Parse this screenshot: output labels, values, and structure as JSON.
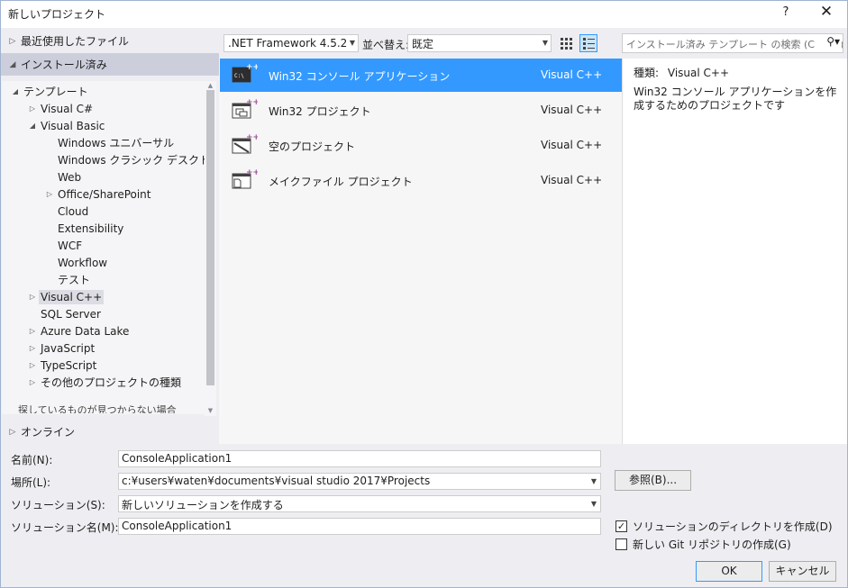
{
  "window": {
    "title": "新しいプロジェクト",
    "help_label": "?",
    "close_label": "✕"
  },
  "left": {
    "recent_label": "最近使用したファイル",
    "installed_label": "インストール済み",
    "online_label": "オンライン",
    "hint": "探しているものが見つからない場合",
    "tree": [
      {
        "label": "テンプレート",
        "level": 0,
        "arrow": "expanded"
      },
      {
        "label": "Visual C#",
        "level": 1,
        "arrow": "collapsed"
      },
      {
        "label": "Visual Basic",
        "level": 1,
        "arrow": "expanded"
      },
      {
        "label": "Windows ユニバーサル",
        "level": 2,
        "arrow": "none"
      },
      {
        "label": "Windows クラシック デスクトップ",
        "level": 2,
        "arrow": "none"
      },
      {
        "label": "Web",
        "level": 2,
        "arrow": "none"
      },
      {
        "label": "Office/SharePoint",
        "level": 2,
        "arrow": "collapsed"
      },
      {
        "label": "Cloud",
        "level": 2,
        "arrow": "none"
      },
      {
        "label": "Extensibility",
        "level": 2,
        "arrow": "none"
      },
      {
        "label": "WCF",
        "level": 2,
        "arrow": "none"
      },
      {
        "label": "Workflow",
        "level": 2,
        "arrow": "none"
      },
      {
        "label": "テスト",
        "level": 2,
        "arrow": "none"
      },
      {
        "label": "Visual C++",
        "level": 1,
        "arrow": "collapsed",
        "selected": true
      },
      {
        "label": "SQL Server",
        "level": 1,
        "arrow": "none"
      },
      {
        "label": "Azure Data Lake",
        "level": 1,
        "arrow": "collapsed"
      },
      {
        "label": "JavaScript",
        "level": 1,
        "arrow": "collapsed"
      },
      {
        "label": "TypeScript",
        "level": 1,
        "arrow": "collapsed"
      },
      {
        "label": "その他のプロジェクトの種類",
        "level": 1,
        "arrow": "collapsed"
      }
    ]
  },
  "toolbar": {
    "framework": ".NET Framework 4.5.2",
    "sort_label": "並べ替え:",
    "sort_value": "既定",
    "search_placeholder": "インストール済み テンプレート の検索 (Ctrl+E)"
  },
  "templates": [
    {
      "name": "Win32 コンソール アプリケーション",
      "lang": "Visual C++",
      "icon": "console-app-icon",
      "selected": true
    },
    {
      "name": "Win32 プロジェクト",
      "lang": "Visual C++",
      "icon": "win32-project-icon",
      "selected": false
    },
    {
      "name": "空のプロジェクト",
      "lang": "Visual C++",
      "icon": "empty-project-icon",
      "selected": false
    },
    {
      "name": "メイクファイル プロジェクト",
      "lang": "Visual C++",
      "icon": "makefile-project-icon",
      "selected": false
    }
  ],
  "description": {
    "type_label": "種類:",
    "type_value": "Visual C++",
    "text": "Win32 コンソール アプリケーションを作成するためのプロジェクトです"
  },
  "form": {
    "name_label": "名前(N):",
    "name_value": "ConsoleApplication1",
    "location_label": "場所(L):",
    "location_value": "c:¥users¥waten¥documents¥visual studio 2017¥Projects",
    "solution_label": "ソリューション(S):",
    "solution_value": "新しいソリューションを作成する",
    "solution_name_label": "ソリューション名(M):",
    "solution_name_value": "ConsoleApplication1",
    "browse_label": "参照(B)...",
    "create_dir_label": "ソリューションのディレクトリを作成(D)",
    "create_dir_checked": true,
    "git_label": "新しい Git リポジトリの作成(G)",
    "git_checked": false,
    "ok_label": "OK",
    "cancel_label": "キャンセル"
  },
  "colors": {
    "accent": "#3399ff",
    "panel": "#eeeef2",
    "cpp_purple": "#9b4f96"
  }
}
